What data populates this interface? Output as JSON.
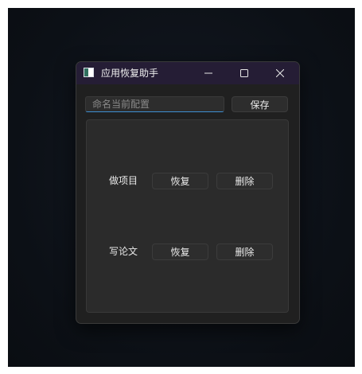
{
  "window": {
    "title": "应用恢复助手"
  },
  "titlebar": {
    "minimize_icon": "minimize-icon",
    "maximize_icon": "maximize-icon",
    "close_icon": "close-icon"
  },
  "config": {
    "name_placeholder": "命名当前配置",
    "name_value": "",
    "save_label": "保存"
  },
  "profiles": [
    {
      "name": "做项目",
      "restore_label": "恢复",
      "delete_label": "删除"
    },
    {
      "name": "写论文",
      "restore_label": "恢复",
      "delete_label": "删除"
    }
  ],
  "colors": {
    "titlebar": "#251d35",
    "window_bg": "#202020",
    "accent": "#3d8fd1"
  }
}
